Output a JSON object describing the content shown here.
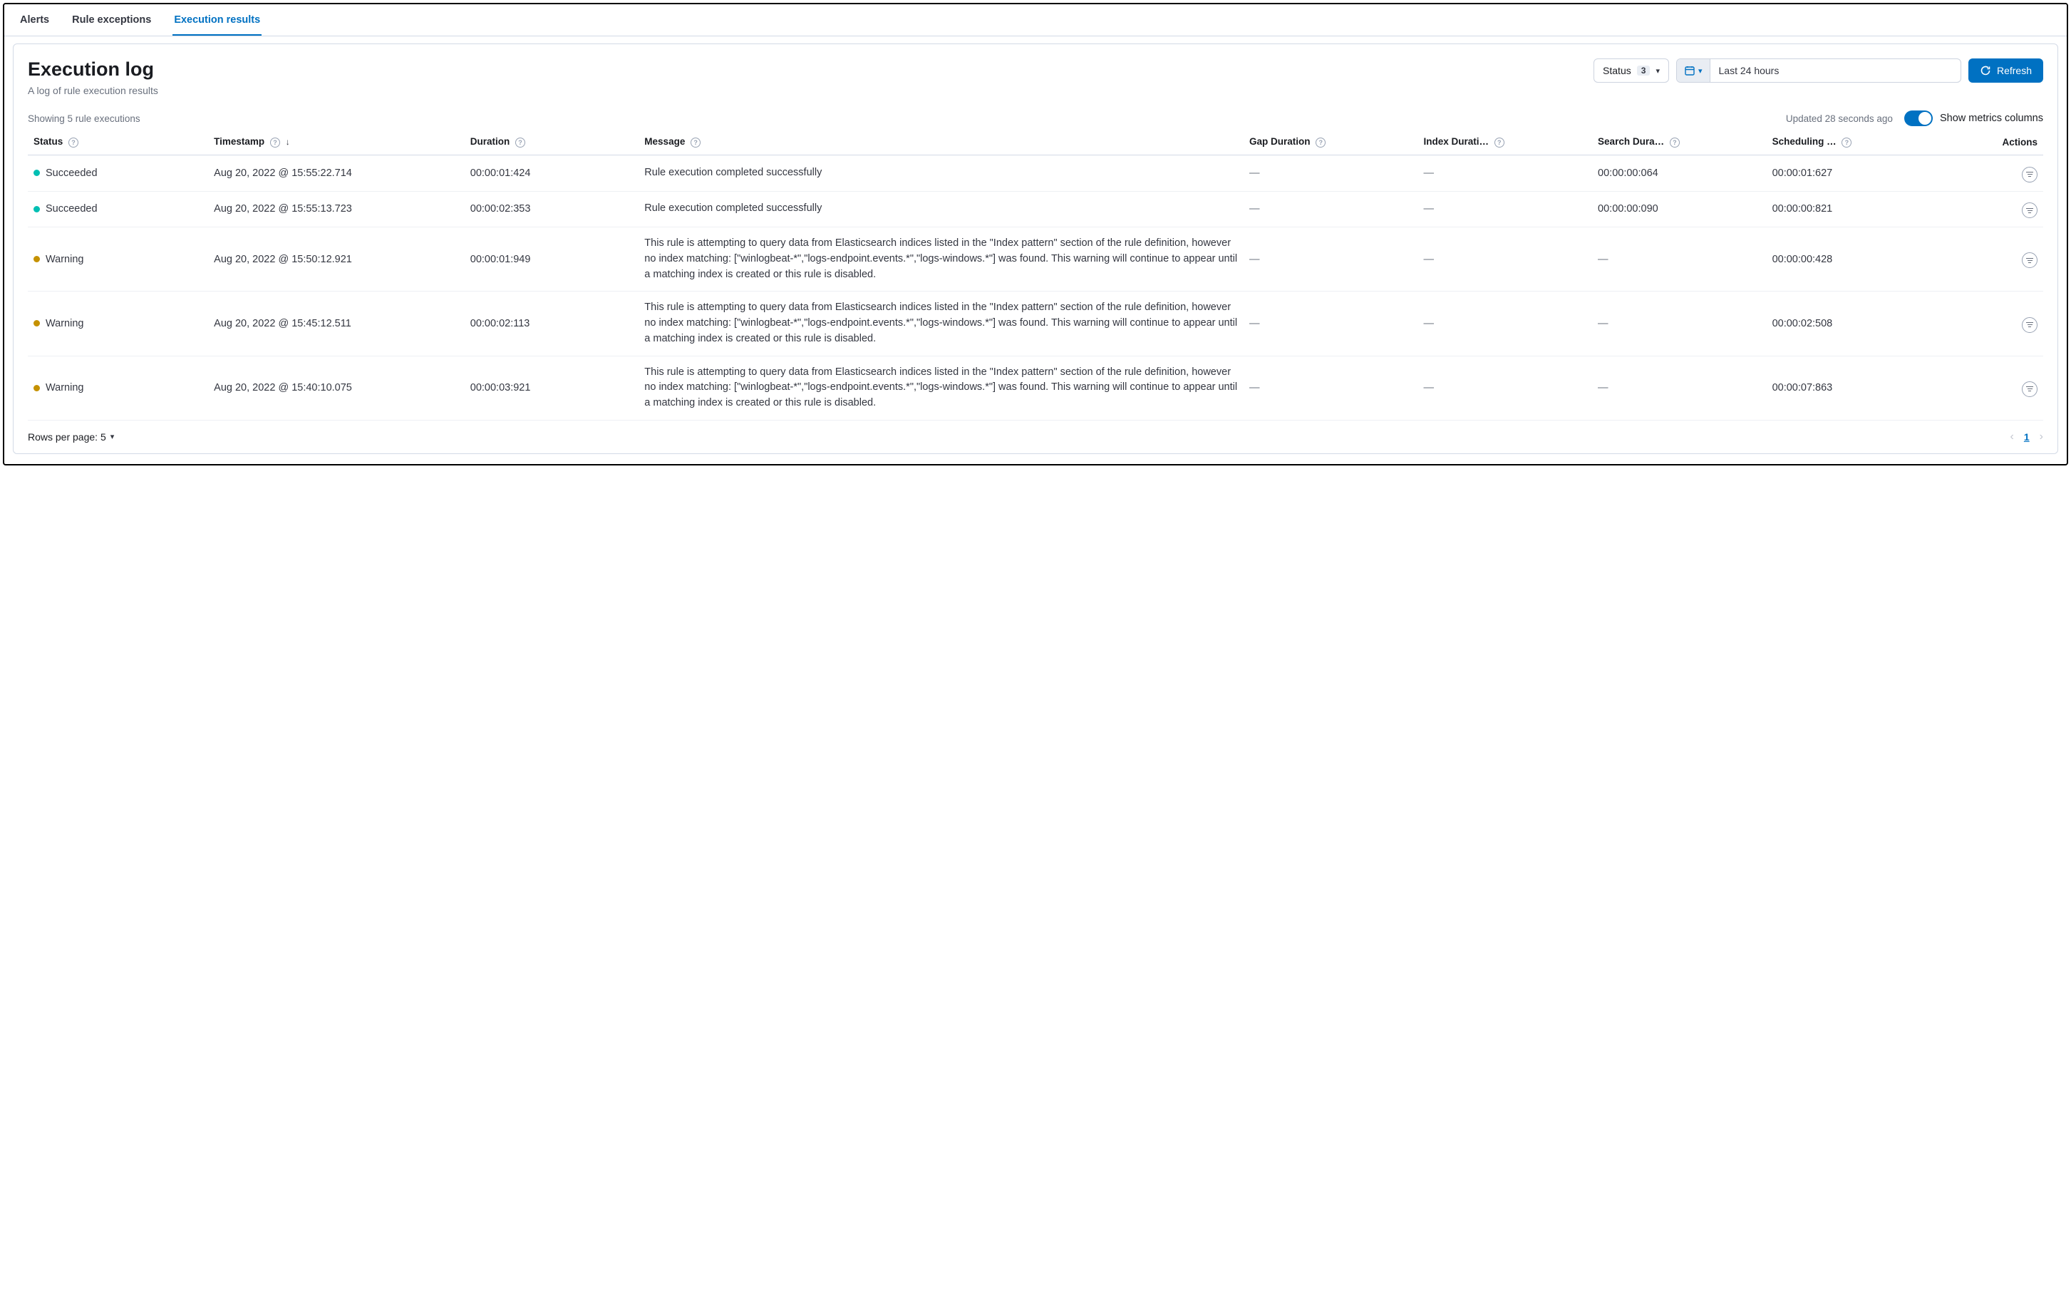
{
  "tabs": {
    "alerts": "Alerts",
    "exceptions": "Rule exceptions",
    "results": "Execution results"
  },
  "header": {
    "title": "Execution log",
    "subtitle": "A log of rule execution results"
  },
  "filters": {
    "status_label": "Status",
    "status_count": "3",
    "date_range": "Last 24 hours",
    "refresh_label": "Refresh"
  },
  "meta": {
    "showing": "Showing 5 rule executions",
    "updated": "Updated 28 seconds ago",
    "toggle_label": "Show metrics columns"
  },
  "columns": {
    "status": "Status",
    "timestamp": "Timestamp",
    "duration": "Duration",
    "message": "Message",
    "gap": "Gap Duration",
    "index": "Index Durati…",
    "search": "Search Dura…",
    "scheduling": "Scheduling …",
    "actions": "Actions"
  },
  "rows": [
    {
      "status": "Succeeded",
      "status_kind": "succeeded",
      "timestamp": "Aug 20, 2022 @ 15:55:22.714",
      "duration": "00:00:01:424",
      "message": "Rule execution completed successfully",
      "gap": "—",
      "index": "—",
      "search": "00:00:00:064",
      "scheduling": "00:00:01:627"
    },
    {
      "status": "Succeeded",
      "status_kind": "succeeded",
      "timestamp": "Aug 20, 2022 @ 15:55:13.723",
      "duration": "00:00:02:353",
      "message": "Rule execution completed successfully",
      "gap": "—",
      "index": "—",
      "search": "00:00:00:090",
      "scheduling": "00:00:00:821"
    },
    {
      "status": "Warning",
      "status_kind": "warning",
      "timestamp": "Aug 20, 2022 @ 15:50:12.921",
      "duration": "00:00:01:949",
      "message": "This rule is attempting to query data from Elasticsearch indices listed in the \"Index pattern\" section of the rule definition, however no index matching: [\"winlogbeat-*\",\"logs-endpoint.events.*\",\"logs-windows.*\"] was found. This warning will continue to appear until a matching index is created or this rule is disabled.",
      "gap": "—",
      "index": "—",
      "search": "—",
      "scheduling": "00:00:00:428"
    },
    {
      "status": "Warning",
      "status_kind": "warning",
      "timestamp": "Aug 20, 2022 @ 15:45:12.511",
      "duration": "00:00:02:113",
      "message": "This rule is attempting to query data from Elasticsearch indices listed in the \"Index pattern\" section of the rule definition, however no index matching: [\"winlogbeat-*\",\"logs-endpoint.events.*\",\"logs-windows.*\"] was found. This warning will continue to appear until a matching index is created or this rule is disabled.",
      "gap": "—",
      "index": "—",
      "search": "—",
      "scheduling": "00:00:02:508"
    },
    {
      "status": "Warning",
      "status_kind": "warning",
      "timestamp": "Aug 20, 2022 @ 15:40:10.075",
      "duration": "00:00:03:921",
      "message": "This rule is attempting to query data from Elasticsearch indices listed in the \"Index pattern\" section of the rule definition, however no index matching: [\"winlogbeat-*\",\"logs-endpoint.events.*\",\"logs-windows.*\"] was found. This warning will continue to appear until a matching index is created or this rule is disabled.",
      "gap": "—",
      "index": "—",
      "search": "—",
      "scheduling": "00:00:07:863"
    }
  ],
  "footer": {
    "rows_per_page_label": "Rows per page: 5",
    "current_page": "1"
  }
}
